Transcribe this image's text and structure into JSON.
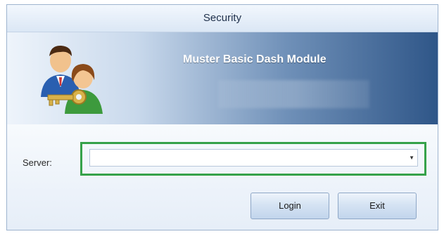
{
  "window": {
    "title": "Security"
  },
  "banner": {
    "title": "Muster Basic Dash Module",
    "icon": "users-key-icon"
  },
  "form": {
    "server_label": "Server:",
    "server_value": "",
    "highlight_color": "#36a24a"
  },
  "buttons": {
    "login": "Login",
    "exit": "Exit"
  }
}
